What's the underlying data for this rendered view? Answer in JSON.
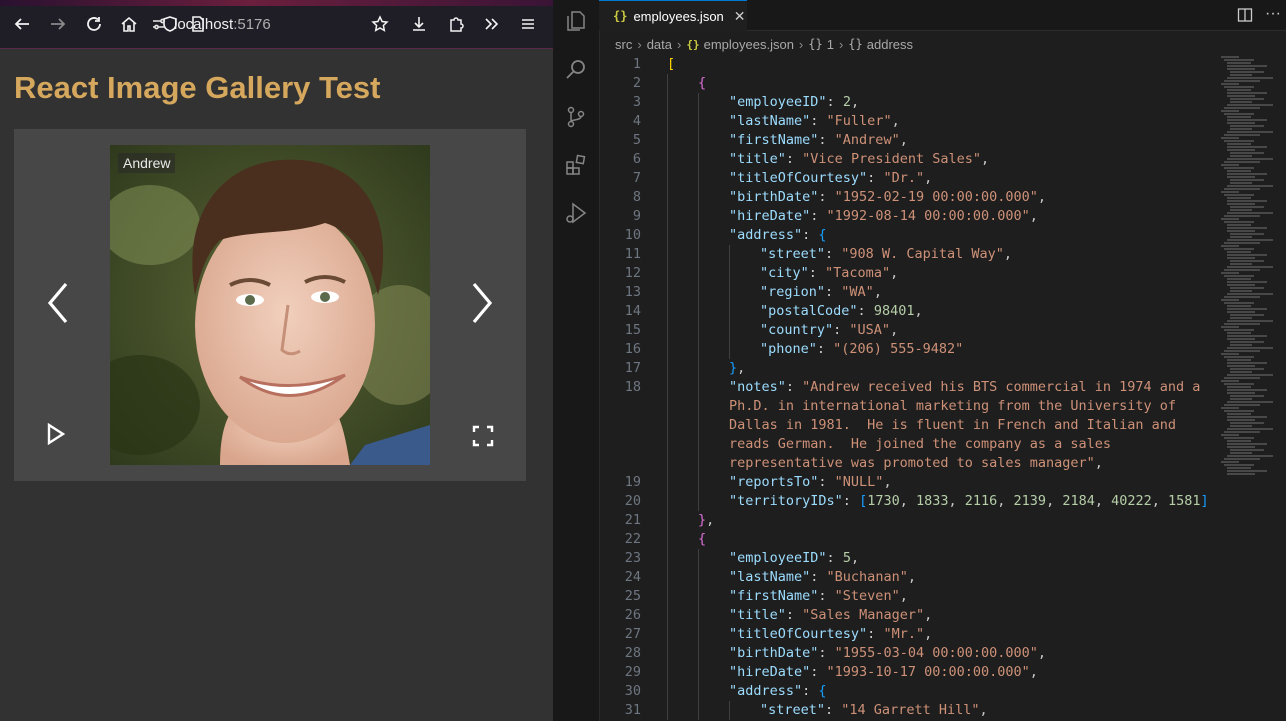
{
  "browser": {
    "url_host": "localhost",
    "url_port": ":5176",
    "page_title": "React Image Gallery Test",
    "gallery": {
      "image_label": "Andrew"
    }
  },
  "editor": {
    "tab": {
      "icon": "{}",
      "label": "employees.json"
    },
    "breadcrumb": [
      "src",
      "data",
      "employees.json",
      "1",
      "address"
    ],
    "lines": [
      {
        "n": "1",
        "indent": 0,
        "t": [
          [
            "b1",
            "["
          ]
        ]
      },
      {
        "n": "2",
        "indent": 1,
        "t": [
          [
            "b2",
            "{"
          ]
        ]
      },
      {
        "n": "3",
        "indent": 2,
        "t": [
          [
            "k",
            "\"employeeID\""
          ],
          [
            "p",
            ": "
          ],
          [
            "n",
            "2"
          ],
          [
            "p",
            ","
          ]
        ]
      },
      {
        "n": "4",
        "indent": 2,
        "t": [
          [
            "k",
            "\"lastName\""
          ],
          [
            "p",
            ": "
          ],
          [
            "s",
            "\"Fuller\""
          ],
          [
            "p",
            ","
          ]
        ]
      },
      {
        "n": "5",
        "indent": 2,
        "t": [
          [
            "k",
            "\"firstName\""
          ],
          [
            "p",
            ": "
          ],
          [
            "s",
            "\"Andrew\""
          ],
          [
            "p",
            ","
          ]
        ]
      },
      {
        "n": "6",
        "indent": 2,
        "t": [
          [
            "k",
            "\"title\""
          ],
          [
            "p",
            ": "
          ],
          [
            "s",
            "\"Vice President Sales\""
          ],
          [
            "p",
            ","
          ]
        ]
      },
      {
        "n": "7",
        "indent": 2,
        "t": [
          [
            "k",
            "\"titleOfCourtesy\""
          ],
          [
            "p",
            ": "
          ],
          [
            "s",
            "\"Dr.\""
          ],
          [
            "p",
            ","
          ]
        ]
      },
      {
        "n": "8",
        "indent": 2,
        "t": [
          [
            "k",
            "\"birthDate\""
          ],
          [
            "p",
            ": "
          ],
          [
            "s",
            "\"1952-02-19 00:00:00.000\""
          ],
          [
            "p",
            ","
          ]
        ]
      },
      {
        "n": "9",
        "indent": 2,
        "t": [
          [
            "k",
            "\"hireDate\""
          ],
          [
            "p",
            ": "
          ],
          [
            "s",
            "\"1992-08-14 00:00:00.000\""
          ],
          [
            "p",
            ","
          ]
        ]
      },
      {
        "n": "10",
        "indent": 2,
        "t": [
          [
            "k",
            "\"address\""
          ],
          [
            "p",
            ": "
          ],
          [
            "b3",
            "{"
          ]
        ]
      },
      {
        "n": "11",
        "indent": 3,
        "t": [
          [
            "k",
            "\"street\""
          ],
          [
            "p",
            ": "
          ],
          [
            "s",
            "\"908 W. Capital Way\""
          ],
          [
            "p",
            ","
          ]
        ]
      },
      {
        "n": "12",
        "indent": 3,
        "t": [
          [
            "k",
            "\"city\""
          ],
          [
            "p",
            ": "
          ],
          [
            "s",
            "\"Tacoma\""
          ],
          [
            "p",
            ","
          ]
        ]
      },
      {
        "n": "13",
        "indent": 3,
        "t": [
          [
            "k",
            "\"region\""
          ],
          [
            "p",
            ": "
          ],
          [
            "s",
            "\"WA\""
          ],
          [
            "p",
            ","
          ]
        ]
      },
      {
        "n": "14",
        "indent": 3,
        "t": [
          [
            "k",
            "\"postalCode\""
          ],
          [
            "p",
            ": "
          ],
          [
            "n",
            "98401"
          ],
          [
            "p",
            ","
          ]
        ]
      },
      {
        "n": "15",
        "indent": 3,
        "t": [
          [
            "k",
            "\"country\""
          ],
          [
            "p",
            ": "
          ],
          [
            "s",
            "\"USA\""
          ],
          [
            "p",
            ","
          ]
        ]
      },
      {
        "n": "16",
        "indent": 3,
        "t": [
          [
            "k",
            "\"phone\""
          ],
          [
            "p",
            ": "
          ],
          [
            "s",
            "\"(206) 555-9482\""
          ]
        ]
      },
      {
        "n": "17",
        "indent": 2,
        "t": [
          [
            "b3",
            "}"
          ],
          [
            "p",
            ","
          ]
        ]
      },
      {
        "n": "18",
        "indent": 2,
        "t": [
          [
            "k",
            "\"notes\""
          ],
          [
            "p",
            ": "
          ],
          [
            "s",
            "\"Andrew received his BTS commercial in 1974 and a"
          ]
        ]
      },
      {
        "n": "",
        "indent": 2,
        "t": [
          [
            "s",
            "Ph.D. in international marketing from the University of"
          ]
        ]
      },
      {
        "n": "",
        "indent": 2,
        "t": [
          [
            "s",
            "Dallas in 1981.  He is fluent in French and Italian and"
          ]
        ]
      },
      {
        "n": "",
        "indent": 2,
        "t": [
          [
            "s",
            "reads German.  He joined the company as a sales"
          ]
        ]
      },
      {
        "n": "",
        "indent": 2,
        "t": [
          [
            "s",
            "representative was promoted to sales manager\""
          ],
          [
            "p",
            ","
          ]
        ]
      },
      {
        "n": "19",
        "indent": 2,
        "t": [
          [
            "k",
            "\"reportsTo\""
          ],
          [
            "p",
            ": "
          ],
          [
            "s",
            "\"NULL\""
          ],
          [
            "p",
            ","
          ]
        ]
      },
      {
        "n": "20",
        "indent": 2,
        "t": [
          [
            "k",
            "\"territoryIDs\""
          ],
          [
            "p",
            ": "
          ],
          [
            "b3",
            "["
          ],
          [
            "n",
            "1730"
          ],
          [
            "p",
            ", "
          ],
          [
            "n",
            "1833"
          ],
          [
            "p",
            ", "
          ],
          [
            "n",
            "2116"
          ],
          [
            "p",
            ", "
          ],
          [
            "n",
            "2139"
          ],
          [
            "p",
            ", "
          ],
          [
            "n",
            "2184"
          ],
          [
            "p",
            ", "
          ],
          [
            "n",
            "40222"
          ],
          [
            "p",
            ", "
          ],
          [
            "n",
            "1581"
          ],
          [
            "b3",
            "]"
          ]
        ]
      },
      {
        "n": "21",
        "indent": 1,
        "t": [
          [
            "b2",
            "}"
          ],
          [
            "p",
            ","
          ]
        ]
      },
      {
        "n": "22",
        "indent": 1,
        "t": [
          [
            "b2",
            "{"
          ]
        ]
      },
      {
        "n": "23",
        "indent": 2,
        "t": [
          [
            "k",
            "\"employeeID\""
          ],
          [
            "p",
            ": "
          ],
          [
            "n",
            "5"
          ],
          [
            "p",
            ","
          ]
        ]
      },
      {
        "n": "24",
        "indent": 2,
        "t": [
          [
            "k",
            "\"lastName\""
          ],
          [
            "p",
            ": "
          ],
          [
            "s",
            "\"Buchanan\""
          ],
          [
            "p",
            ","
          ]
        ]
      },
      {
        "n": "25",
        "indent": 2,
        "t": [
          [
            "k",
            "\"firstName\""
          ],
          [
            "p",
            ": "
          ],
          [
            "s",
            "\"Steven\""
          ],
          [
            "p",
            ","
          ]
        ]
      },
      {
        "n": "26",
        "indent": 2,
        "t": [
          [
            "k",
            "\"title\""
          ],
          [
            "p",
            ": "
          ],
          [
            "s",
            "\"Sales Manager\""
          ],
          [
            "p",
            ","
          ]
        ]
      },
      {
        "n": "27",
        "indent": 2,
        "t": [
          [
            "k",
            "\"titleOfCourtesy\""
          ],
          [
            "p",
            ": "
          ],
          [
            "s",
            "\"Mr.\""
          ],
          [
            "p",
            ","
          ]
        ]
      },
      {
        "n": "28",
        "indent": 2,
        "t": [
          [
            "k",
            "\"birthDate\""
          ],
          [
            "p",
            ": "
          ],
          [
            "s",
            "\"1955-03-04 00:00:00.000\""
          ],
          [
            "p",
            ","
          ]
        ]
      },
      {
        "n": "29",
        "indent": 2,
        "t": [
          [
            "k",
            "\"hireDate\""
          ],
          [
            "p",
            ": "
          ],
          [
            "s",
            "\"1993-10-17 00:00:00.000\""
          ],
          [
            "p",
            ","
          ]
        ]
      },
      {
        "n": "30",
        "indent": 2,
        "t": [
          [
            "k",
            "\"address\""
          ],
          [
            "p",
            ": "
          ],
          [
            "b3",
            "{"
          ]
        ]
      },
      {
        "n": "31",
        "indent": 3,
        "t": [
          [
            "k",
            "\"street\""
          ],
          [
            "p",
            ": "
          ],
          [
            "s",
            "\"14 Garrett Hill\""
          ],
          [
            "p",
            ","
          ]
        ]
      }
    ]
  },
  "icons": {
    "browser": [
      "back-icon",
      "forward-icon",
      "reload-icon",
      "home-icon",
      "shield-icon",
      "page-icon",
      "site-settings-icon",
      "bookmark-star-icon",
      "download-icon",
      "extensions-icon",
      "overflow-chevrons-icon",
      "menu-icon"
    ],
    "gallery": [
      "prev-chevron-icon",
      "next-chevron-icon",
      "play-icon",
      "fullscreen-icon"
    ],
    "activity_bar": [
      "explorer-icon",
      "search-icon",
      "source-control-icon",
      "extensions-icon",
      "run-debug-icon"
    ]
  },
  "colors": {
    "title": "#d6a85e",
    "json_key": "#9cdcfe",
    "json_string": "#ce9178",
    "json_number": "#b5cea8"
  }
}
